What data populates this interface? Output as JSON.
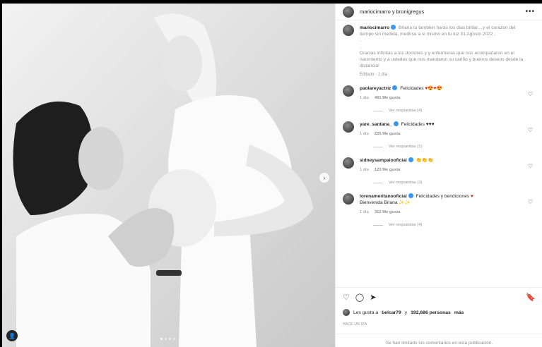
{
  "header": {
    "users": "mariocimarro y bronigregus",
    "more": "•••"
  },
  "caption": {
    "user": "mariocimarro",
    "text_1": "Briana tu tambien harás los dias brillar....y el corazon del tiempo sin medida, medirse a si mismo en tu luz 31 Agosto 2022 .",
    "dot_1": ".",
    "dot_2": ".",
    "text_2": "Gracias infinitas a los doctores y y enfermeras que nos acompañaron en el nacimiento y a ustedes que nos mandaron su cariño y buenos deseos desde la distancia!",
    "meta": "Editado · 1 día"
  },
  "comments": [
    {
      "user": "paolareyactriz",
      "verified": true,
      "text": "Felicidades",
      "emoji": "♥😍♥😍",
      "time": "1 día",
      "likes": "461 Me gusta",
      "replies": "Ver respuestas (4)"
    },
    {
      "user": "yare_santana_",
      "verified": true,
      "text": "Felicidades",
      "emoji": "♥♥♥",
      "time": "1 día",
      "likes": "225 Me gusta",
      "replies": "Ver respuestas (1)"
    },
    {
      "user": "sidneysampaiooficial",
      "verified": true,
      "text": "",
      "emoji": "👏👏👏",
      "time": "1 día",
      "likes": "123 Me gusta",
      "replies": "Ver respuestas (3)"
    },
    {
      "user": "lorenameritanooficial",
      "verified": true,
      "text": "Felicidades y bendiciones",
      "emoji": "♥",
      "text2": "Bienvenida Briana ✨✨",
      "time": "1 día",
      "likes": "312 Me gusta",
      "replies": "Ver respuestas (4)"
    }
  ],
  "likes": {
    "prefix": "Les gusta a",
    "user": "belcar79",
    "middle": "y",
    "count": "192,686 personas",
    "suffix": "más"
  },
  "date": "HACE UN DÍA",
  "closed": "Se han limitado los comentarios en esta publicación.",
  "icons": {
    "heart": "♡",
    "comment": "◯",
    "share": "➤",
    "save": "🔖",
    "next": "›",
    "tag": "👤"
  },
  "colors": {
    "verified": "#3897f0",
    "accent_heart": "#c62828"
  }
}
